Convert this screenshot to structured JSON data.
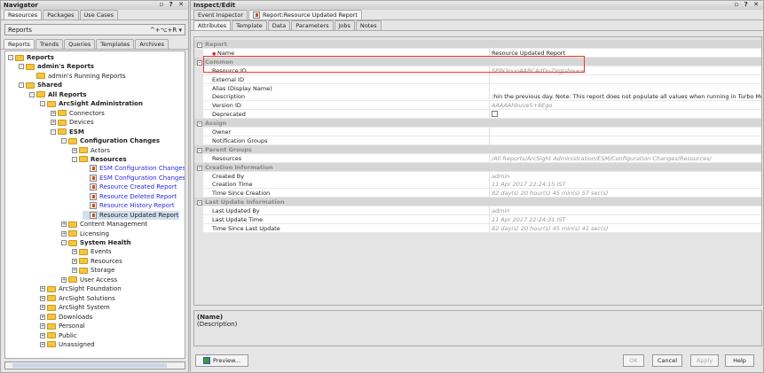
{
  "navigator": {
    "title": "Navigator",
    "controls": "▫ ? ✕",
    "tabs": [
      "Resources",
      "Packages",
      "Use Cases"
    ],
    "combo": {
      "label": "Reports",
      "shortcut": "^+⌥+R ▾"
    },
    "subtabs": [
      "Reports",
      "Trends",
      "Queries",
      "Templates",
      "Archives"
    ],
    "tree": [
      {
        "label": "Reports",
        "level": 0,
        "type": "folder",
        "exp": "-",
        "bold": true
      },
      {
        "label": "admin's Reports",
        "level": 1,
        "type": "folder",
        "exp": "-",
        "bold": true
      },
      {
        "label": "admin's Running Reports",
        "level": 2,
        "type": "special"
      },
      {
        "label": "Shared",
        "level": 1,
        "type": "folder",
        "exp": "-",
        "bold": true
      },
      {
        "label": "All Reports",
        "level": 2,
        "type": "folder",
        "exp": "-",
        "bold": true
      },
      {
        "label": "ArcSight Administration",
        "level": 3,
        "type": "folder",
        "exp": "-",
        "bold": true
      },
      {
        "label": "Connectors",
        "level": 4,
        "type": "folder",
        "exp": "+"
      },
      {
        "label": "Devices",
        "level": 4,
        "type": "folder",
        "exp": "+"
      },
      {
        "label": "ESM",
        "level": 4,
        "type": "folder",
        "exp": "-",
        "bold": true
      },
      {
        "label": "Configuration Changes",
        "level": 5,
        "type": "folder",
        "exp": "-",
        "bold": true
      },
      {
        "label": "Actors",
        "level": 6,
        "type": "folder",
        "exp": "+"
      },
      {
        "label": "Resources",
        "level": 6,
        "type": "folder",
        "exp": "-",
        "bold": true
      },
      {
        "label": "ESM Configuration Changes by",
        "level": 7,
        "type": "report",
        "link": true
      },
      {
        "label": "ESM Configuration Changes by",
        "level": 7,
        "type": "report",
        "link": true
      },
      {
        "label": "Resource Created Report",
        "level": 7,
        "type": "report",
        "link": true
      },
      {
        "label": "Resource Deleted Report",
        "level": 7,
        "type": "report",
        "link": true
      },
      {
        "label": "Resource History Report",
        "level": 7,
        "type": "report",
        "link": true
      },
      {
        "label": "Resource Updated Report",
        "level": 7,
        "type": "report",
        "selected": true
      },
      {
        "label": "Content Management",
        "level": 5,
        "type": "folder",
        "exp": "+"
      },
      {
        "label": "Licensing",
        "level": 5,
        "type": "folder",
        "exp": "+"
      },
      {
        "label": "System Health",
        "level": 5,
        "type": "folder",
        "exp": "-",
        "bold": true
      },
      {
        "label": "Events",
        "level": 6,
        "type": "folder",
        "exp": "+"
      },
      {
        "label": "Resources",
        "level": 6,
        "type": "folder",
        "exp": "+"
      },
      {
        "label": "Storage",
        "level": 6,
        "type": "folder",
        "exp": "+"
      },
      {
        "label": "User Access",
        "level": 5,
        "type": "folder",
        "exp": "+"
      },
      {
        "label": "ArcSight Foundation",
        "level": 3,
        "type": "folder",
        "exp": "+"
      },
      {
        "label": "ArcSight Solutions",
        "level": 3,
        "type": "folder",
        "exp": "+"
      },
      {
        "label": "ArcSight System",
        "level": 3,
        "type": "folder",
        "exp": "+"
      },
      {
        "label": "Downloads",
        "level": 3,
        "type": "folder",
        "exp": "+"
      },
      {
        "label": "Personal",
        "level": 3,
        "type": "folder",
        "exp": "+"
      },
      {
        "label": "Public",
        "level": 3,
        "type": "folder",
        "exp": "+"
      },
      {
        "label": "Unassigned",
        "level": 3,
        "type": "folder",
        "exp": "+"
      }
    ]
  },
  "inspect": {
    "title": "Inspect/Edit",
    "controls": "▫ ? ✕",
    "tabs": [
      "Event Inspector",
      "Report:Resource Updated Report"
    ],
    "subtabs": [
      "Attributes",
      "Template",
      "Data",
      "Parameters",
      "Jobs",
      "Notes"
    ],
    "rows": [
      {
        "group": "Report"
      },
      {
        "key": "Name",
        "value": "Resource Updated Report",
        "required": true
      },
      {
        "group": "Common"
      },
      {
        "key": "Resource ID",
        "value": "SPlN3nuoAABCAdDuZVgJshw==",
        "gray": true
      },
      {
        "key": "External ID",
        "value": ""
      },
      {
        "key": "Alias (Display Name)",
        "value": ""
      },
      {
        "key": "Description",
        "value": ":hin the previous day. Note: This report does not populate all values when running in Turbo Mode Fastest."
      },
      {
        "key": "Version ID",
        "value": "AAAAAhbuve5+8Ego",
        "gray": true
      },
      {
        "key": "Deprecated",
        "checkbox": true
      },
      {
        "group": "Assign"
      },
      {
        "key": "Owner",
        "value": ""
      },
      {
        "key": "Notification Groups",
        "value": ""
      },
      {
        "group": "Parent Groups"
      },
      {
        "key": "Resources",
        "value": "/All Reports/ArcSight Administration/ESM/Configuration Changes/Resources/",
        "gray": true
      },
      {
        "group": "Creation Information"
      },
      {
        "key": "Created By",
        "value": "admin",
        "gray": true
      },
      {
        "key": "Creation Time",
        "value": "11 Apr 2017 22:24:15 IST",
        "gray": true
      },
      {
        "key": "Time Since Creation",
        "value": "82 day(s) 20 hour(s) 45 min(s) 57 sec(s)",
        "gray": true
      },
      {
        "group": "Last Update Information"
      },
      {
        "key": "Last Updated By",
        "value": "admin",
        "gray": true
      },
      {
        "key": "Last Update Time",
        "value": "11 Apr 2017 22:24:31 IST",
        "gray": true
      },
      {
        "key": "Time Since Last Update",
        "value": "82 day(s) 20 hour(s) 45 min(s) 41 sec(s)",
        "gray": true
      }
    ],
    "desc": {
      "name": "(Name)",
      "description": "(Description)"
    },
    "buttons": {
      "preview": "Preview...",
      "ok": "OK",
      "cancel": "Cancel",
      "apply": "Apply",
      "help": "Help"
    }
  }
}
